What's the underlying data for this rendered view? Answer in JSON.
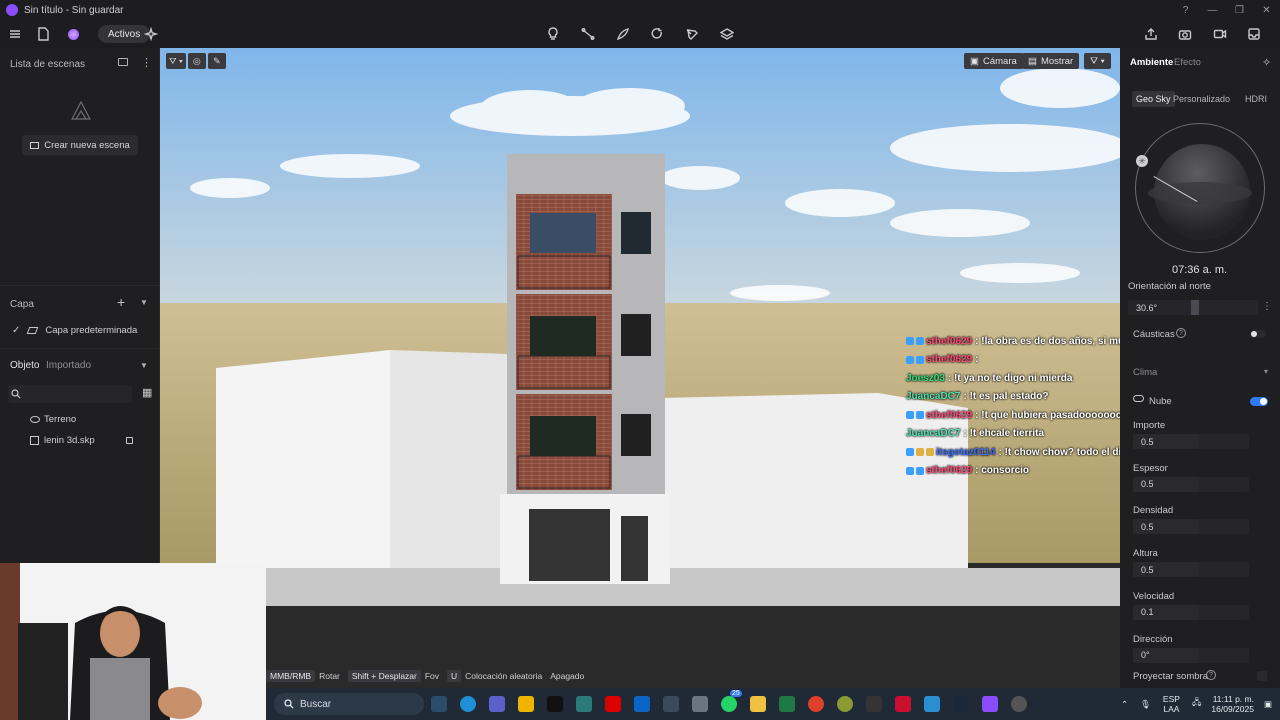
{
  "window": {
    "title": "Sin título - Sin guardar",
    "controls": [
      "?",
      "—",
      "❐",
      "✕"
    ]
  },
  "toolbar": {
    "assets_label": "Activos",
    "center_tools": [
      "lightbulb-icon",
      "path-icon",
      "draw-icon",
      "rotate-icon",
      "pen-icon",
      "layers-icon"
    ],
    "right_tools": [
      "share-icon",
      "camera-icon",
      "video-icon",
      "export-icon"
    ]
  },
  "left_panel": {
    "scene_list_title": "Lista de escenas",
    "create_scene_label": "Crear nueva escena",
    "layer_title": "Capa",
    "default_layer": "Capa predeterminada",
    "object_tab": "Objeto",
    "imported_tab": "Importado",
    "objects": [
      {
        "label": "Terreno",
        "icon": "terrain-icon"
      },
      {
        "label": "lenin 3d.skp",
        "icon": "model-icon",
        "locked": true
      }
    ]
  },
  "viewport": {
    "camera_label": "Cámara",
    "show_label": "Mostrar"
  },
  "chat": [
    {
      "user": "sthef0629",
      "msg": ": !la obra es de dos años, si mucho en enero te inician a pagar",
      "color": "#ff4b7a",
      "badges": [
        "#3aa0ff",
        "#3aa0ff"
      ]
    },
    {
      "user": "sthef0629",
      "msg": ":",
      "color": "#ff4b7a",
      "badges": [
        "#3aa0ff",
        "#3aa0ff"
      ]
    },
    {
      "user": "Joesz03",
      "msg": ": !t ya no te digo ni mierda",
      "color": "#2fe07a",
      "badges": []
    },
    {
      "user": "JuancaDC7",
      "msg": ": !t es pal estado?",
      "color": "#4ee0b0",
      "badges": []
    },
    {
      "user": "sthef0629",
      "msg": ": !t que hubiera pasadoooooooo",
      "color": "#ff4b7a",
      "badges": [
        "#3aa0ff",
        "#3aa0ff"
      ]
    },
    {
      "user": "JuancaDC7",
      "msg": ": !t ehcale tierrita",
      "color": "#4ee0b0",
      "badges": []
    },
    {
      "user": "itsgotaz0114",
      "msg": ": !t chow chow? todo el dia chow dices pes",
      "color": "#3a6cff",
      "badges": [
        "#3aa0ff",
        "#e0b040",
        "#e0b040"
      ]
    },
    {
      "user": "sthef0629",
      "msg": ": consorcio",
      "color": "#ff4b7a",
      "badges": [
        "#3aa0ff",
        "#3aa0ff"
      ]
    }
  ],
  "right_panel": {
    "tab_environment": "Ambiente",
    "tab_effect": "Efecto",
    "sky_tabs": [
      "Geo Sky",
      "Personalizado",
      "HDRI"
    ],
    "time": "07:36 a. m.",
    "north_label": "Orientación al norte",
    "north_value": "30.6°",
    "caustics_label": "Cáusticas",
    "climate_label": "Clima",
    "cloud_label": "Nube",
    "cloud_enabled": true,
    "params": [
      {
        "label": "Importe",
        "value": "0.5"
      },
      {
        "label": "Espesor",
        "value": "0.5"
      },
      {
        "label": "Densidad",
        "value": "0.5"
      },
      {
        "label": "Altura",
        "value": "0.5"
      },
      {
        "label": "Velocidad",
        "value": "0.1"
      },
      {
        "label": "Dirección",
        "value": "0°"
      }
    ],
    "shadow_label": "Proyectar sombra"
  },
  "hints": [
    {
      "key": "MMB/RMB",
      "text": "Rotar"
    },
    {
      "key": "Shift + Desplazar",
      "text": "Fov"
    },
    {
      "key": "U",
      "text": "Colocación aleatoria"
    },
    {
      "key": "",
      "text": "Apagado"
    }
  ],
  "taskbar": {
    "search_placeholder": "Buscar",
    "lang": "ESP",
    "region": "LAA",
    "time": "11:11 p. m.",
    "date": "16/09/2025",
    "badge_count": "25"
  },
  "colors": {
    "accent": "#8a4cff",
    "toggle": "#2f7bf6",
    "sky_top": "#7fb6ea",
    "ground": "#c9b785"
  }
}
